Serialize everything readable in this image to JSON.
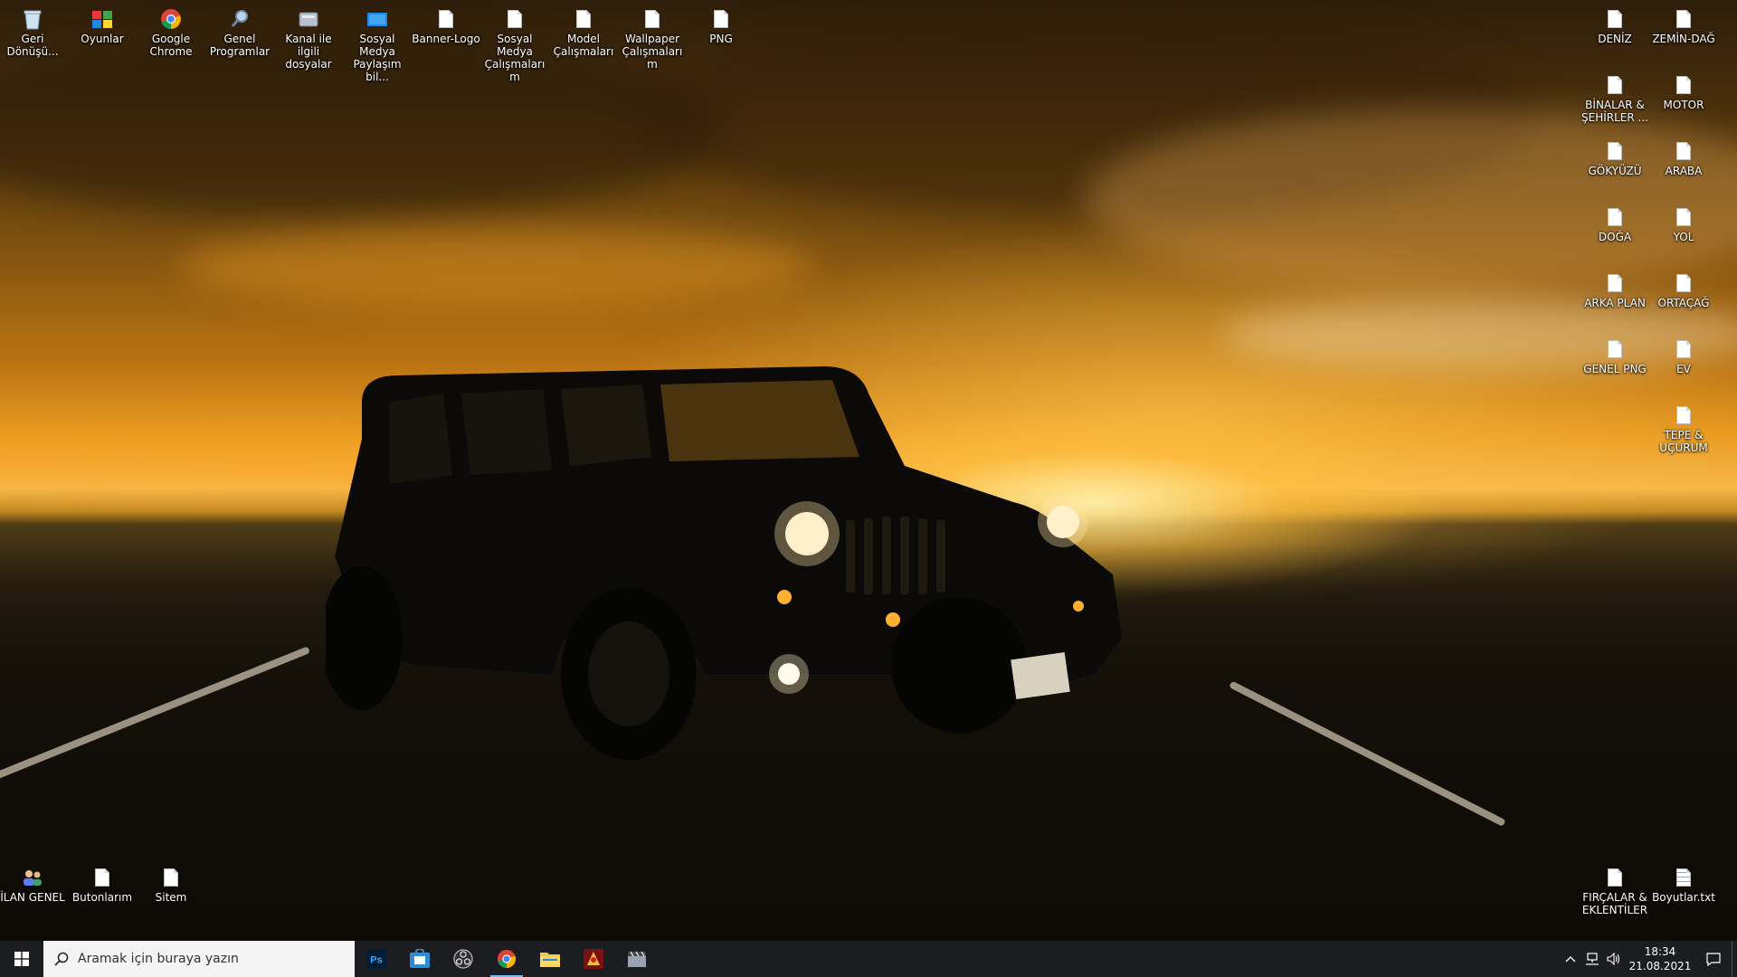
{
  "desktop": {
    "top_icons": [
      {
        "label": "Geri Dönüşü...",
        "icon": "recycle-bin-icon"
      },
      {
        "label": "Oyunlar",
        "icon": "games-folder-icon"
      },
      {
        "label": "Google Chrome",
        "icon": "chrome-icon"
      },
      {
        "label": "Genel Programlar",
        "icon": "search-folder-icon"
      },
      {
        "label": "Kanal ile ilgili dosyalar",
        "icon": "drive-icon"
      },
      {
        "label": "Sosyal Medya Paylaşım bil...",
        "icon": "monitor-folder-icon"
      },
      {
        "label": "Banner-Logo",
        "icon": "file-icon"
      },
      {
        "label": "Sosyal Medya Çalışmalarım",
        "icon": "file-icon"
      },
      {
        "label": "Model Çalışmaları",
        "icon": "file-icon"
      },
      {
        "label": "Wallpaper Çalışmalarım",
        "icon": "file-icon"
      },
      {
        "label": "PNG",
        "icon": "file-icon"
      }
    ],
    "right_icons": [
      {
        "label": "DENİZ",
        "icon": "file-icon"
      },
      {
        "label": "ZEMİN-DAĞ",
        "icon": "file-icon"
      },
      {
        "label": "BİNALAR & ŞEHİRLER ...",
        "icon": "file-icon"
      },
      {
        "label": "MOTOR",
        "icon": "file-icon"
      },
      {
        "label": "GÖKYÜZÜ",
        "icon": "file-icon"
      },
      {
        "label": "ARABA",
        "icon": "file-icon"
      },
      {
        "label": "DOĞA",
        "icon": "file-icon"
      },
      {
        "label": "YOL",
        "icon": "file-icon"
      },
      {
        "label": "ARKA PLAN",
        "icon": "file-icon"
      },
      {
        "label": "ORTAÇAĞ",
        "icon": "file-icon"
      },
      {
        "label": "GENEL PNG",
        "icon": "file-icon"
      },
      {
        "label": "EV",
        "icon": "file-icon"
      },
      {
        "label": "TEPE & UÇURUM",
        "icon": "file-icon"
      }
    ],
    "bottom_left_icons": [
      {
        "label": "İLAN GENEL",
        "icon": "users-folder-icon"
      },
      {
        "label": "Butonlarım",
        "icon": "file-icon"
      },
      {
        "label": "Sitem",
        "icon": "file-icon"
      }
    ],
    "bottom_right_icons": [
      {
        "label": "FIRÇALAR & EKLENTİLER",
        "icon": "file-icon"
      },
      {
        "label": "Boyutlar.txt",
        "icon": "text-file-icon"
      }
    ]
  },
  "taskbar": {
    "search_placeholder": "Aramak için buraya yazın",
    "apps": [
      {
        "name": "photoshop-icon",
        "label": "Ps",
        "active": false
      },
      {
        "name": "shop-app-icon",
        "label": "",
        "active": false
      },
      {
        "name": "obs-icon",
        "label": "",
        "active": false
      },
      {
        "name": "chrome-icon",
        "label": "",
        "active": true
      },
      {
        "name": "file-explorer-icon",
        "label": "",
        "active": false
      },
      {
        "name": "game-app-icon",
        "label": "",
        "active": false
      },
      {
        "name": "clapper-app-icon",
        "label": "",
        "active": false
      }
    ],
    "tray": {
      "time": "18:34",
      "date": "21.08.2021"
    }
  },
  "colors": {
    "taskbar_bg": "#1c1d20",
    "active_indicator": "#76b9ed",
    "search_bg": "#f3f3f3"
  }
}
